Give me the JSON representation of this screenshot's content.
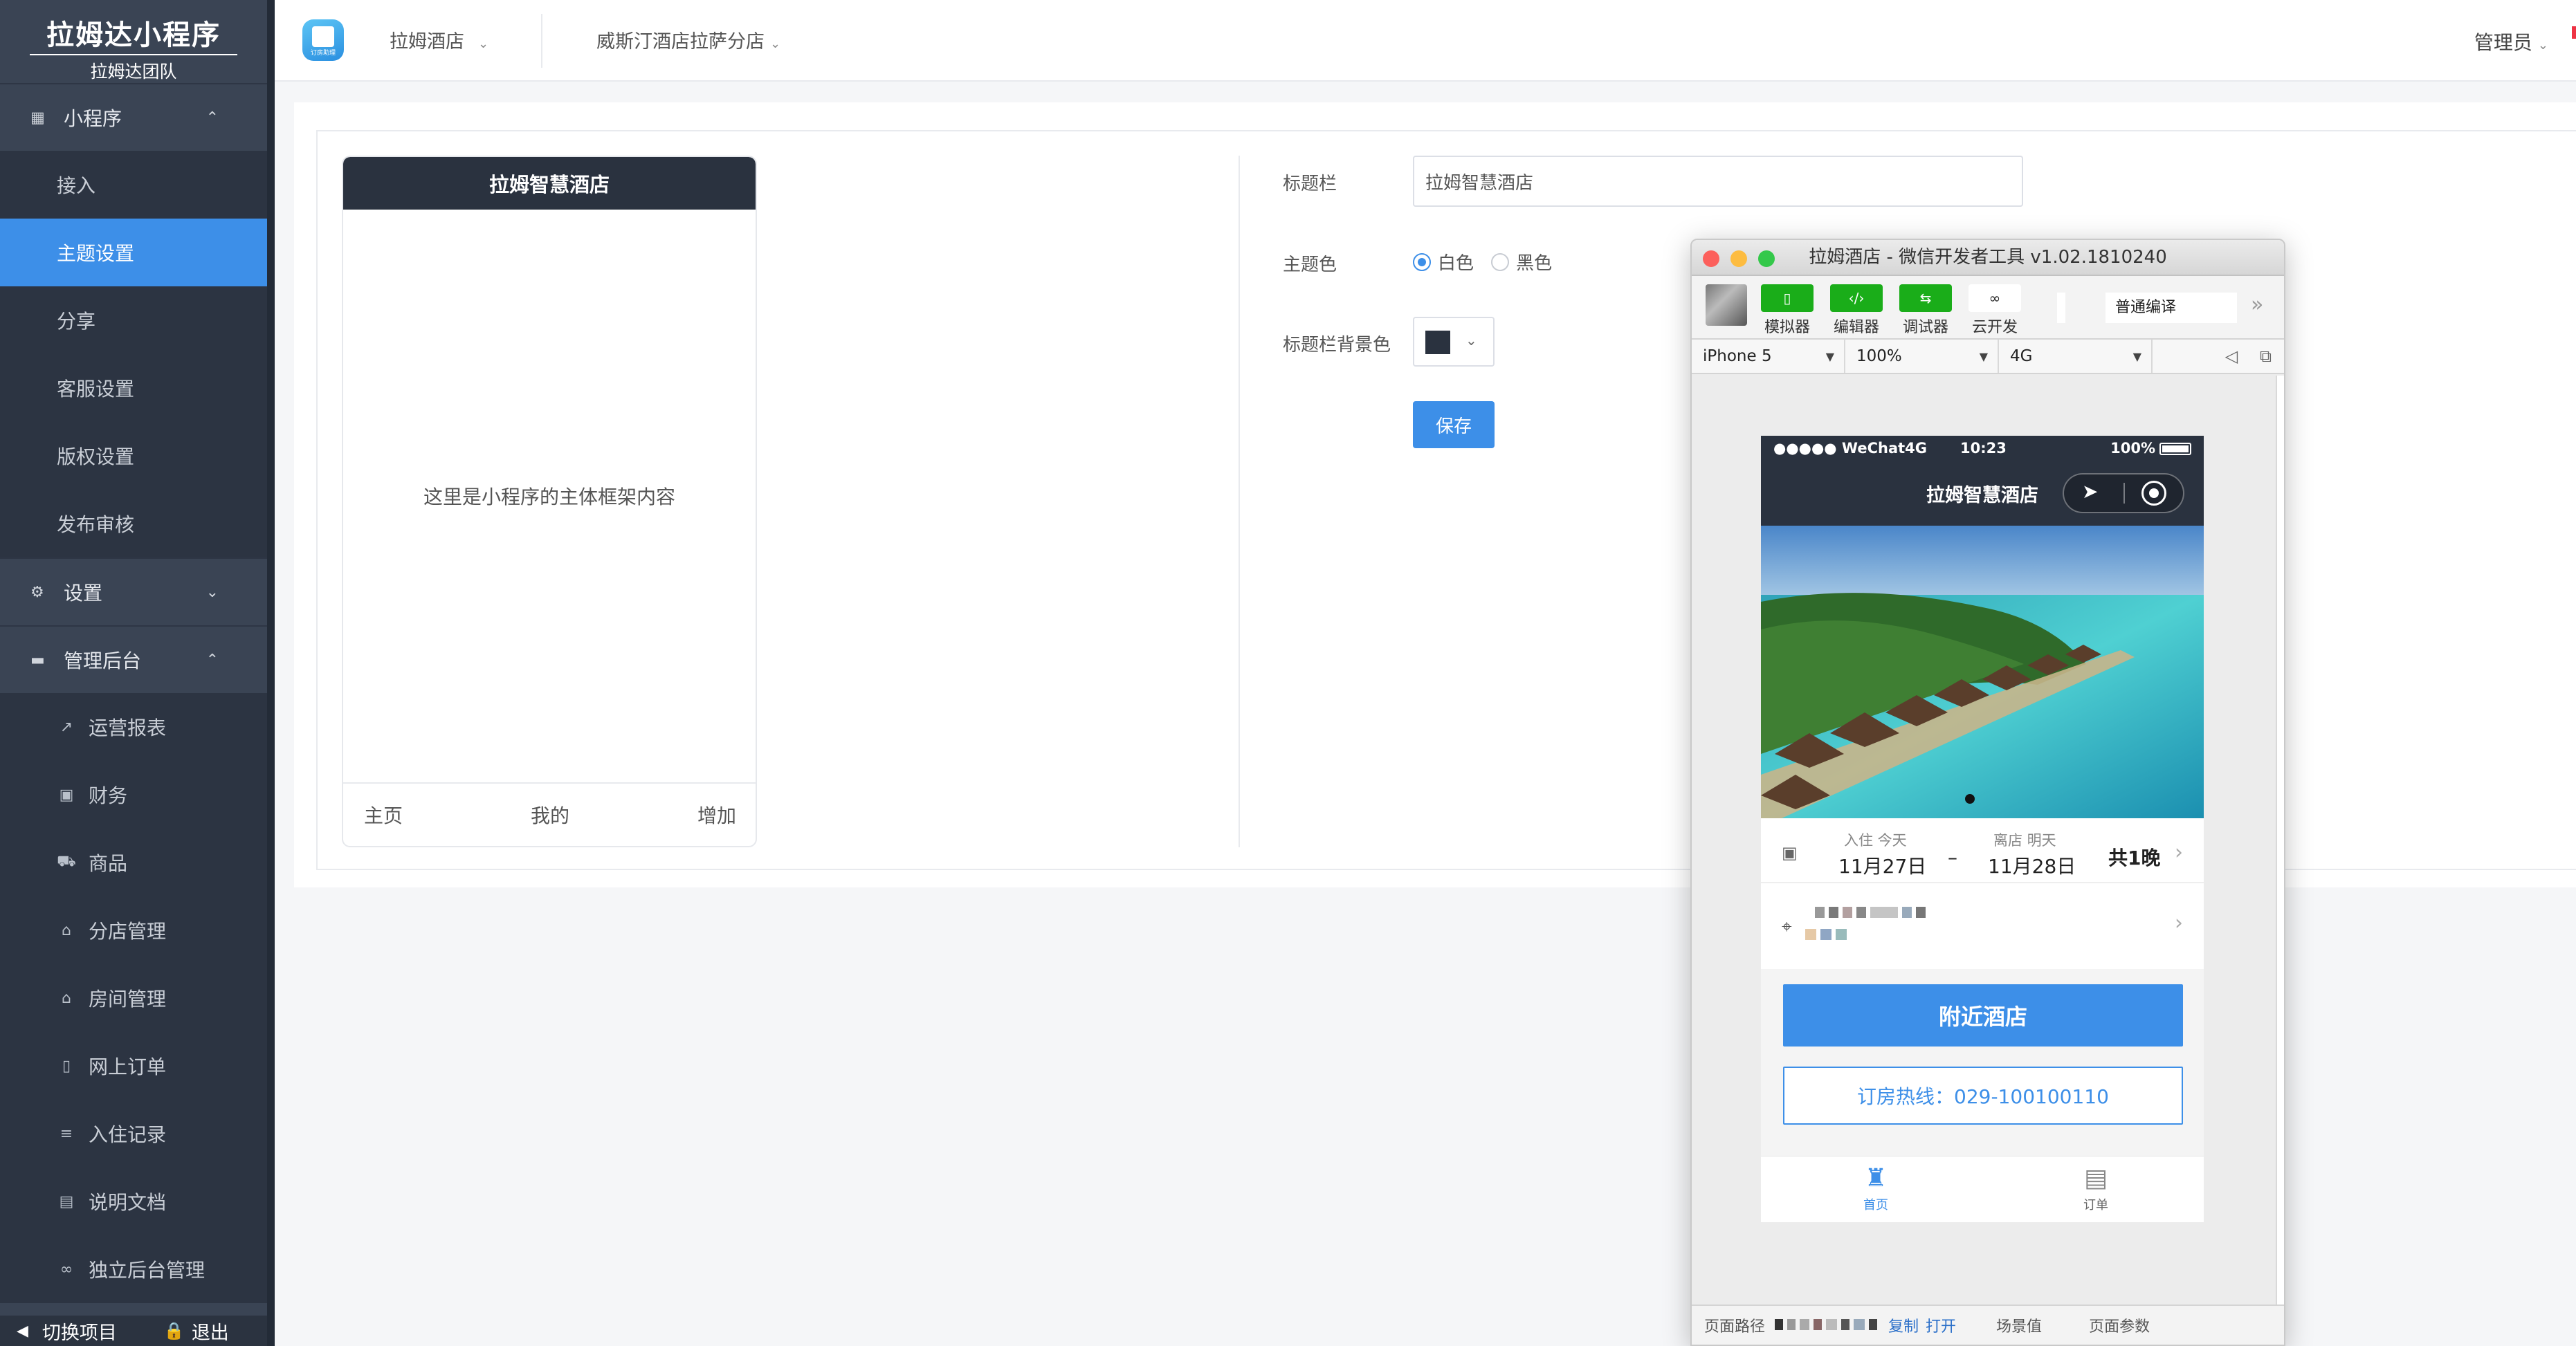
{
  "sidebar": {
    "app_title": "拉姆达小程序",
    "team": "拉姆达团队",
    "groups": [
      {
        "label": "小程序",
        "icon": "grid-icon"
      },
      {
        "label": "设置",
        "icon": "gear-icon"
      },
      {
        "label": "管理后台",
        "icon": "monitor-icon"
      }
    ],
    "mini_items": [
      "接入",
      "主题设置",
      "分享",
      "客服设置",
      "版权设置",
      "发布审核"
    ],
    "admin_items": [
      "运营报表",
      "财务",
      "商品",
      "分店管理",
      "房间管理",
      "网上订单",
      "入住记录",
      "说明文档",
      "独立后台管理"
    ],
    "footer": {
      "switch": "切换项目",
      "logout": "退出"
    },
    "active_item": "主题设置"
  },
  "topbar": {
    "logo_text": "订房助理",
    "hotel_select": "拉姆酒店",
    "branch_select": "威斯汀酒店拉萨分店",
    "user": "管理员"
  },
  "preview": {
    "header_title": "拉姆智慧酒店",
    "body_text": "这里是小程序的主体框架内容",
    "tabs": [
      "主页",
      "我的",
      "增加"
    ]
  },
  "form": {
    "title_label": "标题栏",
    "title_value": "拉姆智慧酒店",
    "theme_label": "主题色",
    "theme_options": [
      "白色",
      "黑色"
    ],
    "theme_selected": "白色",
    "bg_label": "标题栏背景色",
    "bg_color": "#2a323f",
    "save": "保存"
  },
  "devtools": {
    "window_title": "拉姆酒店 - 微信开发者工具 v1.02.1810240",
    "tools": [
      "模拟器",
      "编辑器",
      "调试器",
      "云开发"
    ],
    "compile_mode": "普通编译",
    "device": "iPhone 5",
    "zoom": "100%",
    "network": "4G",
    "footer": {
      "path_label": "页面路径",
      "copy": "复制",
      "open": "打开",
      "scene": "场景值",
      "params": "页面参数"
    }
  },
  "simulator": {
    "carrier": "●●●●● WeChat4G",
    "time": "10:23",
    "battery": "100%",
    "nav_title": "拉姆智慧酒店",
    "checkin_label": "入住 今天",
    "checkin_date": "11月27日",
    "dash": "–",
    "checkout_label": "离店 明天",
    "checkout_date": "11月28日",
    "nights": "共1晚",
    "nearby_button": "附近酒店",
    "hotline": "订房热线：029-100100110",
    "tabs": [
      "首页",
      "订单"
    ]
  },
  "colors": {
    "accent": "#3d8fe8",
    "sidebar_bg": "#3a4454",
    "header_dark": "#2a323f",
    "tool_green": "#1aad19"
  }
}
